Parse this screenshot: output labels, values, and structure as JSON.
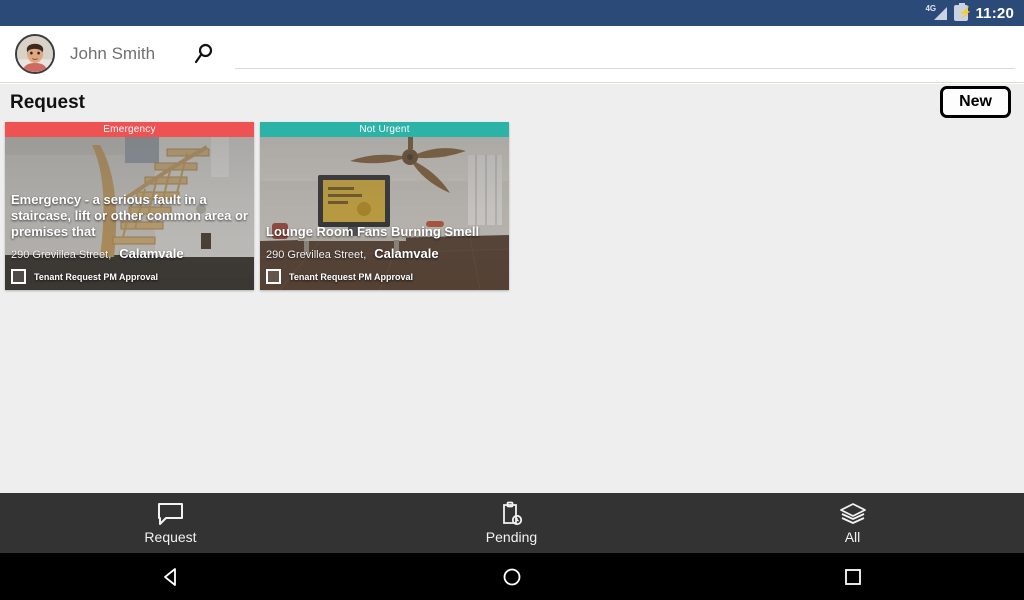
{
  "statusbar": {
    "network_label": "4G",
    "time": "11:20",
    "icons": [
      "signal-4g-icon",
      "battery-charging-icon"
    ],
    "background_color": "#2c4a77"
  },
  "appbar": {
    "avatar_name": "user-avatar",
    "username": "John Smith",
    "search": {
      "icon": "search-icon",
      "value": "",
      "placeholder": ""
    }
  },
  "main": {
    "section_title": "Request",
    "new_button_label": "New",
    "cards": [
      {
        "priority_label": "Emergency",
        "priority_color": "#ee5253",
        "title": "Emergency - a serious fault in a staircase, lift or other common area or premises that",
        "street": "290 Grevillea Street,",
        "suburb": "Calamvale",
        "checkbox_label": "Tenant Request PM Approval",
        "checkbox_checked": false,
        "photo": "staircase-photo"
      },
      {
        "priority_label": "Not Urgent",
        "priority_color": "#2bb3a7",
        "title": "Lounge Room Fans Burning Smell",
        "street": "290 Grevillea Street,",
        "suburb": "Calamvale",
        "checkbox_label": "Tenant Request PM Approval",
        "checkbox_checked": false,
        "photo": "lounge-room-photo"
      }
    ]
  },
  "tabbar": {
    "background_color": "#333333",
    "tabs": [
      {
        "label": "Request",
        "icon": "speech-bubble-icon",
        "active": true
      },
      {
        "label": "Pending",
        "icon": "clipboard-clock-icon",
        "active": false
      },
      {
        "label": "All",
        "icon": "layers-icon",
        "active": false
      }
    ]
  },
  "navbar": {
    "buttons": [
      {
        "name": "back-button",
        "icon": "triangle-back-icon"
      },
      {
        "name": "home-button",
        "icon": "circle-home-icon"
      },
      {
        "name": "recents-button",
        "icon": "square-recents-icon"
      }
    ]
  }
}
